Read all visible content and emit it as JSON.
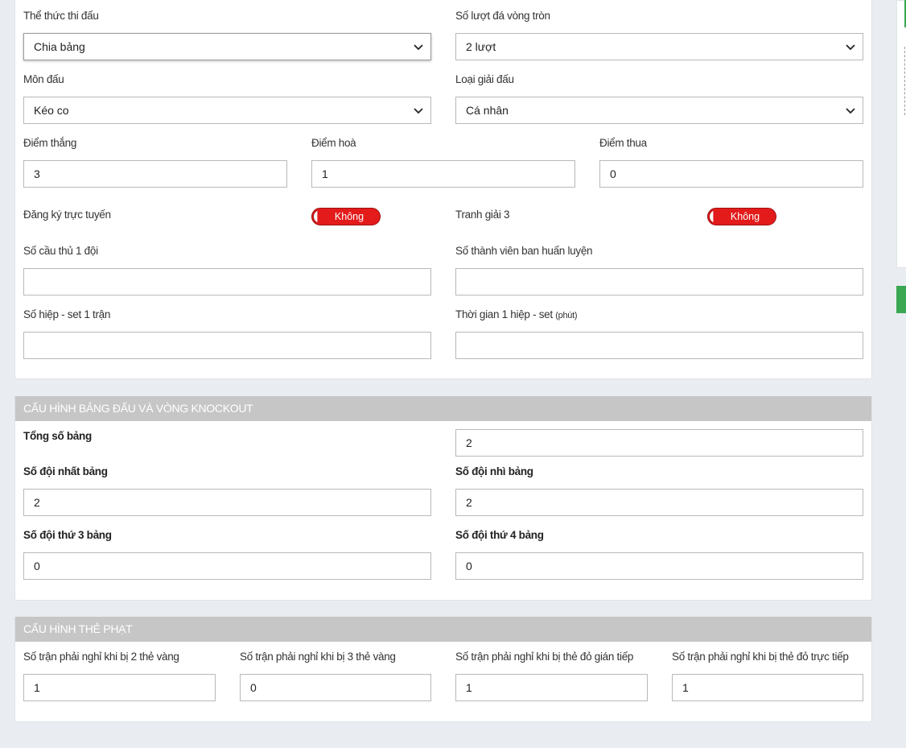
{
  "general": {
    "format": {
      "label": "Thể thức thi đấu",
      "value": "Chia bảng"
    },
    "round_robin": {
      "label": "Số lượt đá vòng tròn",
      "value": "2 lượt"
    },
    "sport": {
      "label": "Môn đấu",
      "value": "Kéo co"
    },
    "tournament_type": {
      "label": "Loại giải đấu",
      "value": "Cá nhân"
    },
    "win_points": {
      "label": "Điểm thắng",
      "value": "3"
    },
    "draw_points": {
      "label": "Điểm hoà",
      "value": "1"
    },
    "loss_points": {
      "label": "Điểm thua",
      "value": "0"
    },
    "online_registration": {
      "label": "Đăng ký trực tuyến",
      "toggle": "Không"
    },
    "third_place": {
      "label": "Tranh giải 3",
      "toggle": "Không"
    },
    "players_per_team": {
      "label": "Số cầu thủ 1 đội",
      "value": ""
    },
    "coaching_staff": {
      "label": "Số thành viên ban huấn luyện",
      "value": ""
    },
    "periods_per_match": {
      "label": "Số hiệp - set 1 trận",
      "value": ""
    },
    "period_duration": {
      "label": "Thời gian 1 hiệp - set",
      "unit": "(phút)",
      "value": ""
    }
  },
  "groups": {
    "title": "CẤU HÌNH BẢNG ĐẤU VÀ VÒNG KNOCKOUT",
    "total_groups": {
      "label": "Tổng số bảng",
      "value": "2"
    },
    "first_place": {
      "label": "Số đội nhất bảng",
      "value": "2"
    },
    "second_place": {
      "label": "Số đội nhì bảng",
      "value": "2"
    },
    "third_place": {
      "label": "Số đội thứ 3 bảng",
      "value": "0"
    },
    "fourth_place": {
      "label": "Số đội thứ 4 bảng",
      "value": "0"
    }
  },
  "penalties": {
    "title": "CẤU HÌNH THẺ PHẠT",
    "two_yellow": {
      "label": "Số trận phải nghỉ khi bị 2 thẻ vàng",
      "value": "1"
    },
    "three_yellow": {
      "label": "Số trận phải nghỉ khi bị 3 thẻ vàng",
      "value": "0"
    },
    "indirect_red": {
      "label": "Số trận phải nghỉ khi bị thẻ đỏ gián tiếp",
      "value": "1"
    },
    "direct_red": {
      "label": "Số trận phải nghỉ khi bị thẻ đỏ trực tiếp",
      "value": "1"
    }
  },
  "colors": {
    "toggle_off": "#e31b1b",
    "header_bg": "#c6c6c6",
    "accent_green": "#3aa852"
  }
}
